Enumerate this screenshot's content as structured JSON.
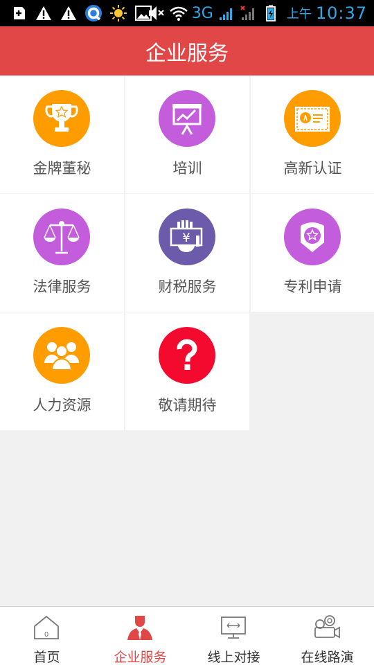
{
  "status_bar": {
    "network": "3G",
    "ampm": "上午",
    "time": "10:37"
  },
  "header": {
    "title": "企业服务"
  },
  "services": [
    {
      "label": "金牌董秘",
      "icon": "trophy-icon",
      "color": "#ff9c00"
    },
    {
      "label": "培训",
      "icon": "presentation-board-icon",
      "color": "#c45ddc"
    },
    {
      "label": "高新认证",
      "icon": "certificate-icon",
      "color": "#ff9c00"
    },
    {
      "label": "法律服务",
      "icon": "scales-icon",
      "color": "#c45ddc"
    },
    {
      "label": "财税服务",
      "icon": "money-hand-icon",
      "color": "#6c5bab"
    },
    {
      "label": "专利申请",
      "icon": "patent-badge-icon",
      "color": "#c45ddc"
    },
    {
      "label": "人力资源",
      "icon": "people-group-icon",
      "color": "#ff9c00"
    },
    {
      "label": "敬请期待",
      "icon": "question-mark-icon",
      "color": "#f30a2e"
    }
  ],
  "bottom_nav": [
    {
      "label": "首页",
      "icon": "home-icon"
    },
    {
      "label": "企业服务",
      "icon": "business-person-icon",
      "active": true
    },
    {
      "label": "线上对接",
      "icon": "monitor-icon"
    },
    {
      "label": "在线路演",
      "icon": "video-camera-icon"
    }
  ],
  "colors": {
    "accent": "#e24747",
    "active_nav": "#e24747"
  }
}
